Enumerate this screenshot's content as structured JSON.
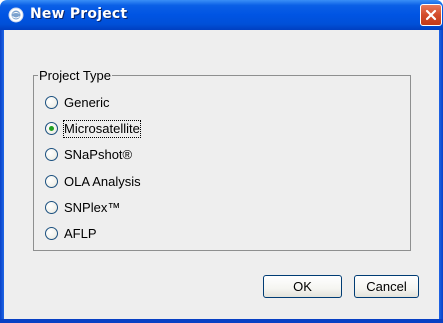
{
  "window": {
    "title": "New Project",
    "title_icon": "app-icon",
    "close_icon": "close-icon"
  },
  "project_type": {
    "legend": "Project Type",
    "options": [
      {
        "label": "Generic",
        "selected": false
      },
      {
        "label": "Microsatellite",
        "selected": true
      },
      {
        "label": "SNaPshot®",
        "selected": false
      },
      {
        "label": "OLA Analysis",
        "selected": false
      },
      {
        "label": "SNPlex™",
        "selected": false
      },
      {
        "label": "AFLP",
        "selected": false
      }
    ]
  },
  "buttons": {
    "ok_label": "OK",
    "cancel_label": "Cancel"
  },
  "colors": {
    "titlebar": "#0054e3",
    "close_button": "#d24c2b",
    "radio_selected_dot": "#21a121",
    "dialog_background": "#eeeeee"
  }
}
